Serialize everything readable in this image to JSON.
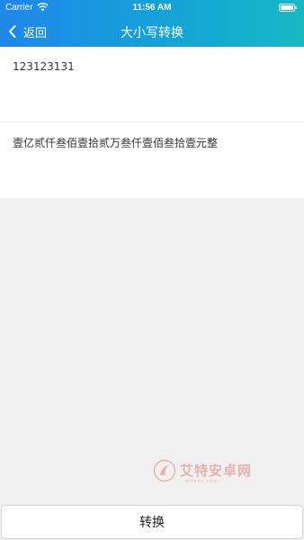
{
  "status_bar": {
    "carrier": "Carrier",
    "time": "11:56 AM",
    "wifi_icon": "wifi-icon",
    "battery_icon": "battery-icon"
  },
  "nav": {
    "back_label": "返回",
    "back_icon": "chevron-left-icon",
    "title": "大小写转换"
  },
  "input": {
    "value": "123123131"
  },
  "output": {
    "value": "壹亿贰仟叁佰壹拾贰万叁仟壹佰叁拾壹元整"
  },
  "watermark": {
    "text": "艾特安卓网",
    "sub": "aitezz.com"
  },
  "actions": {
    "convert_label": "转换"
  },
  "colors": {
    "header_start": "#1f86ea",
    "header_end": "#17b8c4",
    "background": "#f0f0f0"
  }
}
